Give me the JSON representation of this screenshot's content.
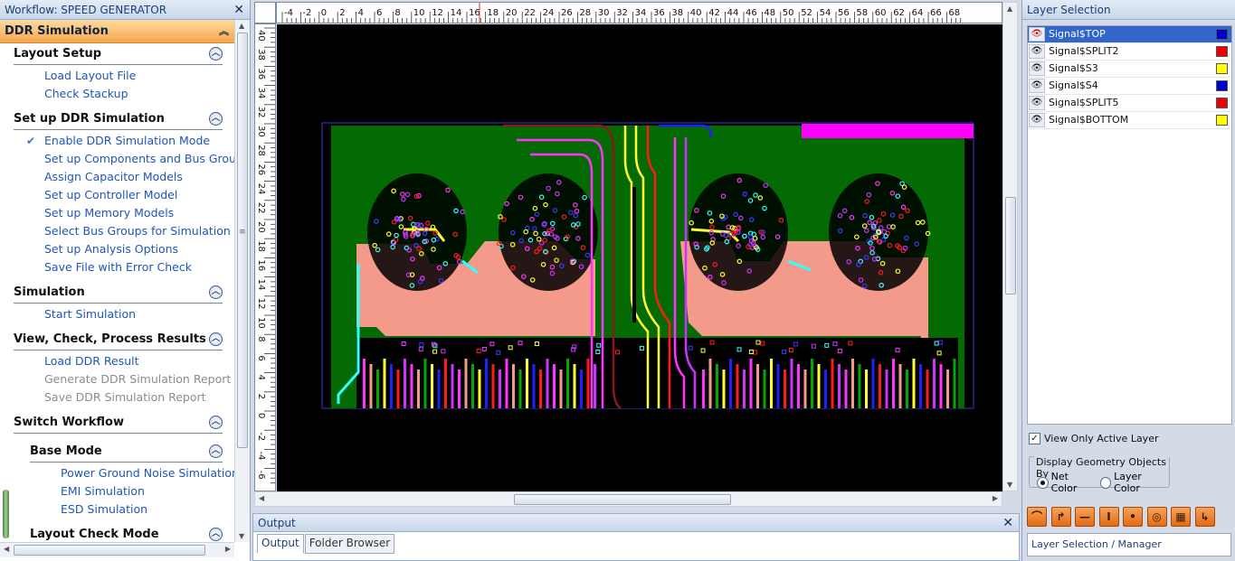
{
  "workflow": {
    "title": "Workflow: SPEED GENERATOR",
    "header": "DDR Simulation",
    "sections": [
      {
        "title": "Layout Setup",
        "sub": false,
        "items": [
          {
            "label": "Load Layout File"
          },
          {
            "label": "Check Stackup"
          }
        ]
      },
      {
        "title": "Set up DDR Simulation",
        "sub": false,
        "items": [
          {
            "label": "Enable DDR Simulation Mode",
            "checked": true
          },
          {
            "label": "Set up Components and Bus Groups"
          },
          {
            "label": "Assign Capacitor Models"
          },
          {
            "label": "Set up Controller Model"
          },
          {
            "label": "Set up Memory Models"
          },
          {
            "label": "Select Bus Groups for Simulation"
          },
          {
            "label": "Set up Analysis Options"
          },
          {
            "label": "Save File with Error Check"
          }
        ]
      },
      {
        "title": "Simulation",
        "sub": false,
        "items": [
          {
            "label": "Start Simulation"
          }
        ]
      },
      {
        "title": "View, Check, Process Results",
        "sub": false,
        "items": [
          {
            "label": "Load DDR Result"
          },
          {
            "label": "Generate DDR Simulation Report",
            "disabled": true
          },
          {
            "label": "Save DDR Simulation Report",
            "disabled": true
          }
        ]
      },
      {
        "title": "Switch Workflow",
        "sub": false,
        "items": []
      },
      {
        "title": "Base Mode",
        "sub": true,
        "items": [
          {
            "label": "Power Ground Noise Simulation"
          },
          {
            "label": "EMI Simulation"
          },
          {
            "label": "ESD Simulation"
          }
        ]
      },
      {
        "title": "Layout Check Mode",
        "sub": true,
        "items": []
      }
    ]
  },
  "ruler": {
    "top_labels": [
      "-4",
      "-2",
      "0",
      "2",
      "4",
      "6",
      "8",
      "10",
      "12",
      "14",
      "16",
      "18",
      "20",
      "22",
      "24",
      "26",
      "28",
      "30",
      "32",
      "34",
      "36",
      "38",
      "40",
      "42",
      "44",
      "46",
      "48",
      "50",
      "52",
      "54",
      "56",
      "58",
      "60",
      "62",
      "64",
      "66",
      "68"
    ],
    "left_labels": [
      "40",
      "38",
      "36",
      "34",
      "32",
      "30",
      "28",
      "26",
      "24",
      "22",
      "20",
      "18",
      "16",
      "14",
      "12",
      "10",
      "8",
      "6",
      "4",
      "2",
      "0",
      "-2",
      "-4",
      "-6"
    ]
  },
  "output": {
    "title": "Output",
    "tabs": [
      "Output",
      "Folder Browser"
    ]
  },
  "layers": {
    "title": "Layer Selection",
    "items": [
      {
        "name": "Signal$TOP",
        "color": "#0000cc",
        "selected": true
      },
      {
        "name": "Signal$SPLIT2",
        "color": "#ee0000"
      },
      {
        "name": "Signal$S3",
        "color": "#ffff00"
      },
      {
        "name": "Signal$S4",
        "color": "#0000cc"
      },
      {
        "name": "Signal$SPLIT5",
        "color": "#ee0000"
      },
      {
        "name": "Signal$BOTTOM",
        "color": "#ffff00"
      }
    ],
    "view_only_active": "View Only Active Layer",
    "display_by": "Display Geometry Objects By",
    "net_color": "Net Color",
    "layer_color": "Layer Color",
    "tools": [
      "arc-tool-icon",
      "corner-tool-icon",
      "line-tool-icon",
      "via-tool-icon",
      "point-tool-icon",
      "pad-tool-icon",
      "component-tool-icon",
      "bend-tool-icon"
    ],
    "bottom_tab": "Layer Selection / Manager"
  }
}
